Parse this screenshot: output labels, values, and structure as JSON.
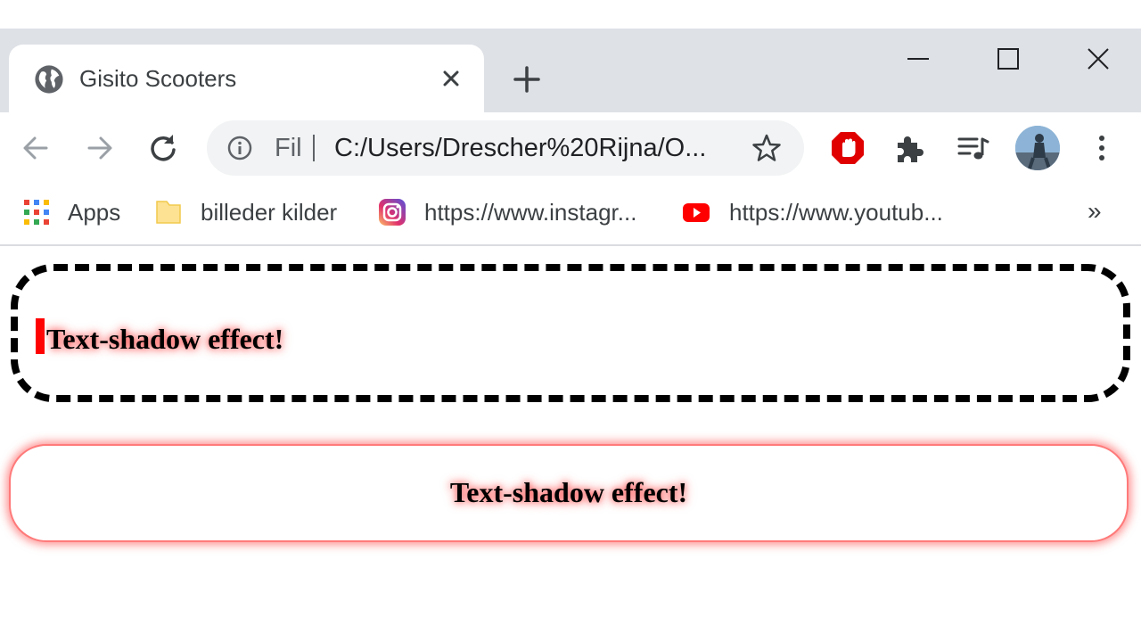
{
  "browser": {
    "tab": {
      "title": "Gisito Scooters",
      "icon": "globe-icon"
    },
    "address_bar": {
      "scheme_label": "Fil",
      "url": "C:/Users/Drescher%20Rijna/O..."
    },
    "bookmarks": [
      {
        "label": "Apps",
        "icon": "apps-grid-icon"
      },
      {
        "label": "billeder kilder",
        "icon": "folder-icon"
      },
      {
        "label": "https://www.instagr...",
        "icon": "instagram-icon"
      },
      {
        "label": "https://www.youtub...",
        "icon": "youtube-icon"
      }
    ],
    "bookmarks_overflow": "»",
    "colors": {
      "tabstrip": "#dee1e6",
      "omnibox": "#f1f3f4",
      "adblock_red": "#e00000"
    }
  },
  "page": {
    "box1": {
      "text": "Text-shadow effect!",
      "border": "dashed black"
    },
    "box2": {
      "text": "Text-shadow effect!",
      "glow_color": "#ff5a5a"
    }
  }
}
